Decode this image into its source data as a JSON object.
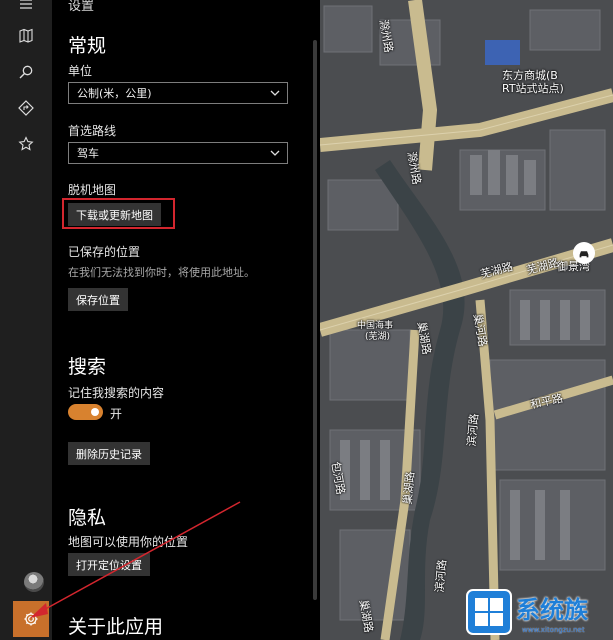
{
  "panel": {
    "top_title": "设置",
    "general": {
      "heading": "常规",
      "unit_label": "单位",
      "unit_value": "公制(米，公里)",
      "route_label": "首选路线",
      "route_value": "驾车",
      "offline_label": "脱机地图",
      "download_button": "下载或更新地图",
      "saved_label": "已保存的位置",
      "saved_note": "在我们无法找到你时，将使用此地址。",
      "save_button": "保存位置"
    },
    "search": {
      "heading": "搜索",
      "remember_label": "记住我搜索的内容",
      "toggle_state": "开",
      "clear_button": "删除历史记录"
    },
    "privacy": {
      "heading": "隐私",
      "location_label": "地图可以使用你的位置",
      "location_button": "打开定位设置"
    },
    "about_heading": "关于此应用"
  },
  "rail": {
    "icons": [
      "hamburger-icon",
      "map-icon",
      "search-icon",
      "directions-icon",
      "favorites-icon",
      "avatar",
      "gear-icon"
    ]
  },
  "map": {
    "labels": {
      "road1": "滁州路",
      "road2": "滁州路",
      "road3": "芜湖路",
      "road4": "芜湖路",
      "road5": "巢湖路",
      "road6": "巢河路",
      "road7": "滨河路",
      "road8": "和平路",
      "road9": "包河路",
      "road10": "巢湖路",
      "road11": "滨河路",
      "road12": "巢湖路",
      "poi1": "东方商城(B",
      "poi2": "RT站式站点)",
      "poi3": "御景湾",
      "poi4": "中国海事",
      "poi5": "(芜湖)"
    },
    "colors": {
      "road": "#c9bb8f",
      "building": "#5a5c62",
      "river": "#3b4347"
    }
  },
  "watermark": {
    "text": "系统族",
    "url": "www.xitongzu.net"
  },
  "colors": {
    "accent": "#c8702b",
    "highlight": "#d3262e",
    "toggle": "#d8822f"
  }
}
